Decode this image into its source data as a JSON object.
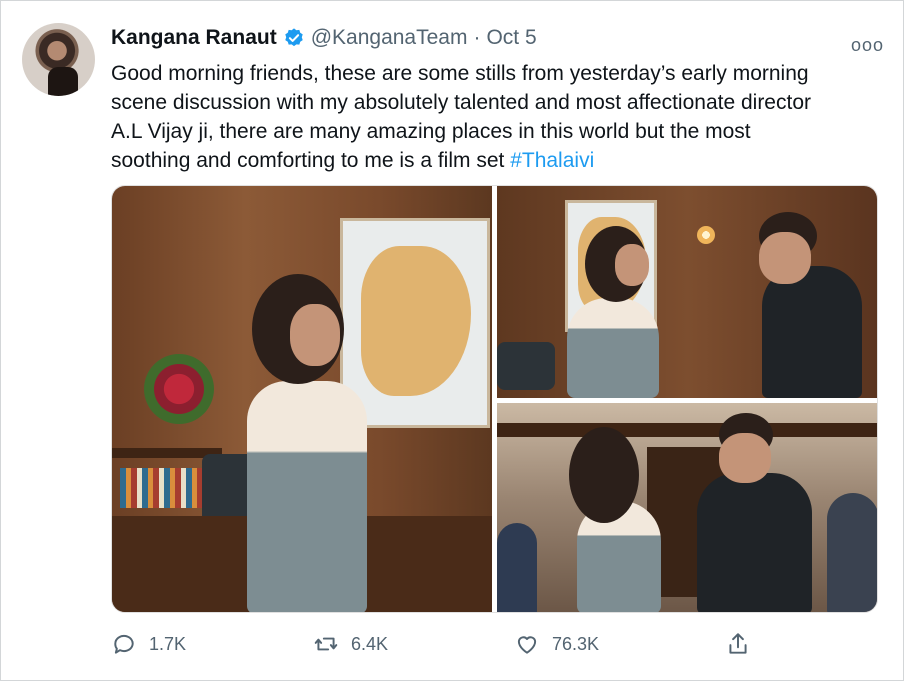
{
  "tweet": {
    "author_name": "Kangana Ranaut",
    "handle": "@KanganaTeam",
    "separator": "·",
    "date": "Oct 5",
    "more_label": "ooo",
    "text_lines": [
      "Good morning friends, these are some stills from yesterday’s early morning",
      "scene discussion with my absolutely talented and most affectionate director",
      "A.L Vijay ji, there are many amazing places in this world but the most",
      "soothing and comforting to me is a film set "
    ],
    "hashtag": "#Thalaivi"
  },
  "actions": {
    "reply_count": "1.7K",
    "retweet_count": "6.4K",
    "like_count": "76.3K",
    "icons": [
      "reply-icon",
      "retweet-icon",
      "like-icon",
      "share-icon"
    ]
  },
  "colors": {
    "link": "#1d9bf0",
    "secondary_text": "#536471",
    "verified_badge": "#1d9bf0"
  }
}
